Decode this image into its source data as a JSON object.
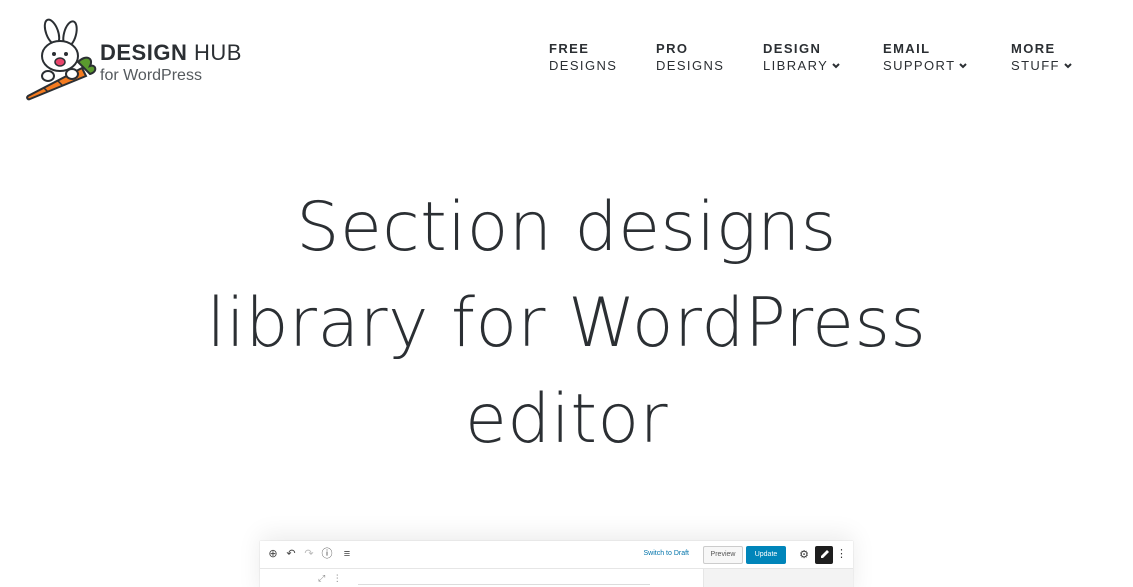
{
  "brand": {
    "name_bold": "DESIGN",
    "name_light": "HUB",
    "tagline": "for WordPress",
    "mascot_icon": "bunny-carrot-icon",
    "colors": {
      "carrot": "#f47b20",
      "leaf": "#5a9a2e",
      "text": "#2b2f33"
    }
  },
  "nav": {
    "items": [
      {
        "line1": "FREE",
        "line2": "DESIGNS",
        "dropdown": false
      },
      {
        "line1": "PRO",
        "line2": "DESIGNS",
        "dropdown": false
      },
      {
        "line1": "DESIGN",
        "line2": "LIBRARY",
        "dropdown": true
      },
      {
        "line1": "EMAIL",
        "line2": "SUPPORT",
        "dropdown": true
      },
      {
        "line1": "MORE",
        "line2": "STUFF",
        "dropdown": true
      }
    ]
  },
  "hero": {
    "lines": [
      "Section designs",
      "library for WordPress",
      "editor"
    ]
  },
  "editor_preview": {
    "toolbar_icons": [
      "add-block-icon",
      "undo-icon",
      "redo-icon",
      "info-icon",
      "outline-icon"
    ],
    "switch_to_draft": "Switch to Draft",
    "preview": "Preview",
    "update": "Update",
    "accent": "#0085ba"
  }
}
